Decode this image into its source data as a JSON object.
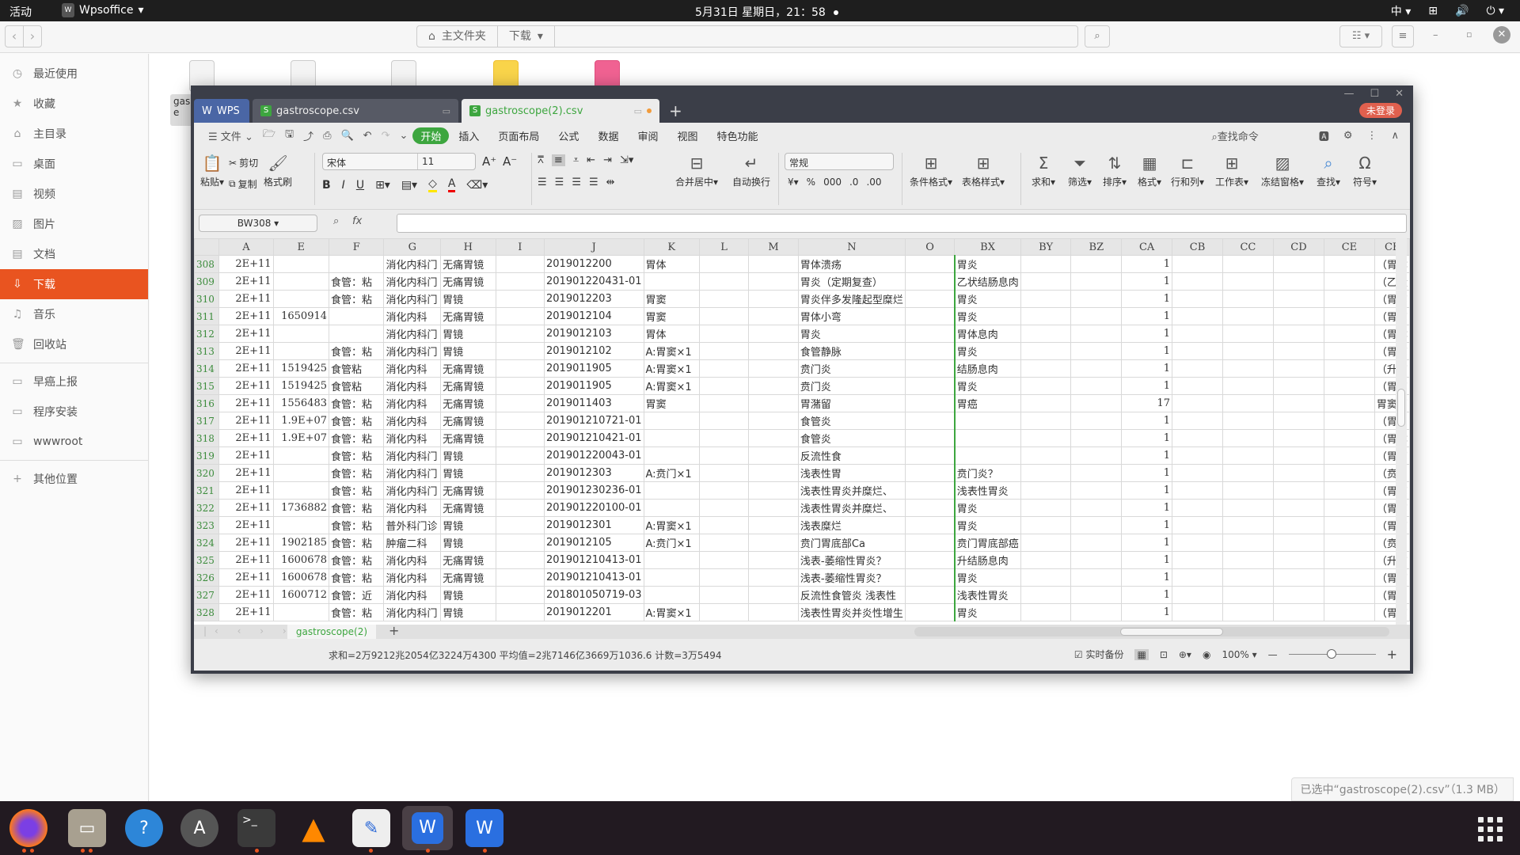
{
  "topbar": {
    "activities": "活动",
    "app_name": "Wpsoffice",
    "clock": "5月31日 星期日，21：58",
    "input_method": "中"
  },
  "filemanager": {
    "path": [
      "主文件夹",
      "下载"
    ],
    "sidebar": [
      {
        "icon": "clock-icon",
        "glyph": "◷",
        "label": "最近使用"
      },
      {
        "icon": "star-icon",
        "glyph": "★",
        "label": "收藏"
      },
      {
        "icon": "home-icon",
        "glyph": "⌂",
        "label": "主目录"
      },
      {
        "icon": "desktop-icon",
        "glyph": "▭",
        "label": "桌面"
      },
      {
        "icon": "video-icon",
        "glyph": "▤",
        "label": "视频"
      },
      {
        "icon": "picture-icon",
        "glyph": "▨",
        "label": "图片"
      },
      {
        "icon": "document-icon",
        "glyph": "▤",
        "label": "文档"
      },
      {
        "icon": "download-icon",
        "glyph": "⇩",
        "label": "下载",
        "active": true
      },
      {
        "icon": "music-icon",
        "glyph": "♫",
        "label": "音乐"
      },
      {
        "icon": "trash-icon",
        "glyph": "🗑",
        "label": "回收站"
      }
    ],
    "bookmarks": [
      {
        "icon": "folder-icon",
        "glyph": "▭",
        "label": "早癌上报"
      },
      {
        "icon": "folder-icon",
        "glyph": "▭",
        "label": "程序安装"
      },
      {
        "icon": "folder-icon",
        "glyph": "▭",
        "label": "wwwroot"
      }
    ],
    "other_locations": "其他位置",
    "partial_file_label": "gas e",
    "selection_status": "已选中“gastroscope(2).csv”（1.3 MB）"
  },
  "wps": {
    "tabs": [
      {
        "label": "WPS"
      },
      {
        "label": "gastroscope.csv"
      },
      {
        "label": "gastroscope(2).csv",
        "active": true,
        "unsaved": true
      }
    ],
    "login_label": "未登录",
    "menu": {
      "file": "文件",
      "items": [
        "开始",
        "插入",
        "页面布局",
        "公式",
        "数据",
        "审阅",
        "视图",
        "特色功能"
      ],
      "active": "开始",
      "search": "查找命令"
    },
    "ribbon": {
      "paste": "粘贴",
      "cut": "剪切",
      "copy": "复制",
      "format_painter": "格式刷",
      "font_name": "宋体",
      "font_size": "11",
      "merge_center": "合并居中",
      "wrap_text": "自动换行",
      "number_format": "常规",
      "conditional_format": "条件格式",
      "table_style": "表格样式",
      "sum": "求和",
      "filter": "筛选",
      "sort": "排序",
      "format": "格式",
      "rows_cols": "行和列",
      "worksheet": "工作表",
      "freeze": "冻结窗格",
      "find": "查找",
      "symbol": "符号"
    },
    "name_box": "BW308",
    "formula": "",
    "columns": [
      "A",
      "E",
      "F",
      "G",
      "H",
      "I",
      "J",
      "K",
      "L",
      "M",
      "N",
      "O",
      "BX",
      "BY",
      "BZ",
      "CA",
      "CB",
      "CC",
      "CD",
      "CE",
      "CF"
    ],
    "rows": [
      {
        "n": "308",
        "A": "2E+11",
        "E": "",
        "F": "",
        "G": "消化内科门",
        "H": "无痛胃镜",
        "J": "2019012200",
        "K": "胃体",
        "N": "胃体溃疡",
        "BX": "胃炎",
        "CA": "1",
        "CF": "（胃体"
      },
      {
        "n": "309",
        "A": "2E+11",
        "E": "",
        "F": "食管：粘",
        "G": "消化内科门",
        "H": "无痛胃镜",
        "J": "201901220431-01",
        "K": "",
        "N": "胃炎（定期复查）",
        "BX": "乙状结肠息肉",
        "CA": "1",
        "CF": "（乙状"
      },
      {
        "n": "310",
        "A": "2E+11",
        "E": "",
        "F": "食管：粘",
        "G": "消化内科门",
        "H": "胃镜",
        "J": "2019012203",
        "K": "胃窦",
        "N": "胃炎伴多发隆起型糜烂",
        "BX": "胃炎",
        "CA": "1",
        "CF": "（胃窦"
      },
      {
        "n": "311",
        "A": "2E+11",
        "E": "1650914",
        "F": "",
        "G": "消化内科",
        "H": "无痛胃镜",
        "J": "2019012104",
        "K": "胃窦",
        "N": "胃体小弯",
        "BX": "胃炎",
        "CA": "1",
        "CF": "（胃窦"
      },
      {
        "n": "312",
        "A": "2E+11",
        "E": "",
        "F": "",
        "G": "消化内科门",
        "H": "胃镜",
        "J": "2019012103",
        "K": "胃体",
        "N": "胃炎",
        "BX": "胃体息肉",
        "CA": "1",
        "CF": "（胃体"
      },
      {
        "n": "313",
        "A": "2E+11",
        "E": "",
        "F": "食管：粘",
        "G": "消化内科门",
        "H": "胃镜",
        "J": "2019012102",
        "K": "A:胃窦×1",
        "N": "食管静脉",
        "BX": "胃炎",
        "CA": "1",
        "CF": "（胃窦"
      },
      {
        "n": "314",
        "A": "2E+11",
        "E": "1519425",
        "F": "食管粘",
        "G": "消化内科",
        "H": "无痛胃镜",
        "J": "2019011905",
        "K": "A:胃窦×1",
        "N": "贲门炎",
        "BX": "结肠息肉",
        "CA": "1",
        "CF": "（升结"
      },
      {
        "n": "315",
        "A": "2E+11",
        "E": "1519425",
        "F": "食管粘",
        "G": "消化内科",
        "H": "无痛胃镜",
        "J": "2019011905",
        "K": "A:胃窦×1",
        "N": "贲门炎",
        "BX": "胃炎",
        "CA": "1",
        "CF": "（胃窦"
      },
      {
        "n": "316",
        "A": "2E+11",
        "E": "1556483",
        "F": "食管：粘",
        "G": "消化内科",
        "H": "无痛胃镜",
        "J": "2019011403",
        "K": "胃窦",
        "N": "胃潴留",
        "BX": "胃癌",
        "CA": "17",
        "CF": "胃窦部"
      },
      {
        "n": "317",
        "A": "2E+11",
        "E": "1.9E+07",
        "F": "食管：粘",
        "G": "消化内科",
        "H": "无痛胃镜",
        "J": "201901210721-01",
        "K": "",
        "N": "食管炎",
        "BX": "",
        "CA": "1",
        "CF": "（胃角"
      },
      {
        "n": "318",
        "A": "2E+11",
        "E": "1.9E+07",
        "F": "食管：粘",
        "G": "消化内科",
        "H": "无痛胃镜",
        "J": "201901210421-01",
        "K": "",
        "N": "食管炎",
        "BX": "",
        "CA": "1",
        "CF": "（胃体"
      },
      {
        "n": "319",
        "A": "2E+11",
        "E": "",
        "F": "食管：粘",
        "G": "消化内科门",
        "H": "胃镜",
        "J": "201901220043-01",
        "K": "",
        "N": "反流性食",
        "BX": "",
        "CA": "1",
        "CF": "（胃窦"
      },
      {
        "n": "320",
        "A": "2E+11",
        "E": "",
        "F": "食管：粘",
        "G": "消化内科门",
        "H": "胃镜",
        "J": "2019012303",
        "K": "A:贲门×1",
        "N": "浅表性胃",
        "BX": "贲门炎？",
        "CA": "1",
        "CF": "（贲门"
      },
      {
        "n": "321",
        "A": "2E+11",
        "E": "",
        "F": "食管：粘",
        "G": "消化内科门",
        "H": "无痛胃镜",
        "J": "201901230236-01",
        "K": "",
        "N": "  浅表性胃炎并糜烂、",
        "BX": "浅表性胃炎",
        "CA": "1",
        "CF": "（胃窦"
      },
      {
        "n": "322",
        "A": "2E+11",
        "E": "1736882",
        "F": "食管：粘",
        "G": "消化内科",
        "H": "无痛胃镜",
        "J": "201901220100-01",
        "K": "",
        "N": "  浅表性胃炎并糜烂、",
        "BX": "胃炎",
        "CA": "1",
        "CF": "（胃窦"
      },
      {
        "n": "323",
        "A": "2E+11",
        "E": "",
        "F": "食管：粘",
        "G": "普外科门诊",
        "H": "胃镜",
        "J": "2019012301",
        "K": "A:胃窦×1",
        "N": "浅表糜烂",
        "BX": "胃炎",
        "CA": "1",
        "CF": "（胃窦"
      },
      {
        "n": "324",
        "A": "2E+11",
        "E": "1902185",
        "F": "食管：粘",
        "G": "肿瘤二科",
        "H": "胃镜",
        "J": "2019012105",
        "K": "A:贲门×1",
        "N": "贲门胃底部Ca",
        "BX": "贲门胃底部癌",
        "CA": "1",
        "CF": "（贲门"
      },
      {
        "n": "325",
        "A": "2E+11",
        "E": "1600678",
        "F": "食管：粘",
        "G": "消化内科",
        "H": "无痛胃镜",
        "J": "201901210413-01",
        "K": "",
        "N": "浅表-萎缩性胃炎？",
        "BX": "升结肠息肉",
        "CA": "1",
        "CF": "（升结"
      },
      {
        "n": "326",
        "A": "2E+11",
        "E": "1600678",
        "F": "食管：粘",
        "G": "消化内科",
        "H": "无痛胃镜",
        "J": "201901210413-01",
        "K": "",
        "N": "浅表-萎缩性胃炎？",
        "BX": "胃炎",
        "CA": "1",
        "CF": "（胃窦"
      },
      {
        "n": "327",
        "A": "2E+11",
        "E": "1600712",
        "F": "食管：近",
        "G": "消化内科",
        "H": "胃镜",
        "J": "201801050719-03",
        "K": "",
        "N": "反流性食管炎 浅表性",
        "BX": "浅表性胃炎",
        "CA": "1",
        "CF": "（胃角"
      },
      {
        "n": "328",
        "A": "2E+11",
        "E": "",
        "F": "食管：粘",
        "G": "消化内科门",
        "H": "胃镜",
        "J": "2019012201",
        "K": "A:胃窦×1",
        "N": "浅表性胃炎并炎性增生",
        "BX": "胃炎",
        "CA": "1",
        "CF": "（胃窦"
      }
    ],
    "sheet_tab": "gastroscope(2)",
    "status": {
      "stats": "求和=2万9212兆2054亿3224万4300  平均值=2兆7146亿3669万1036.6  计数=3万5494",
      "backup": "实时备份",
      "zoom": "100%"
    }
  },
  "colors": {
    "accent_green": "#3da63f",
    "ubuntu_orange": "#e95420",
    "login_red": "#e0604e"
  }
}
